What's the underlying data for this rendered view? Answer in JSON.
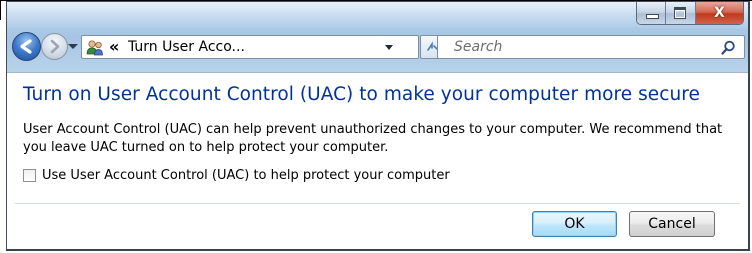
{
  "window": {
    "caption_buttons": {
      "minimize": "minimize",
      "maximize": "maximize",
      "close_glyph": "X"
    }
  },
  "address_bar": {
    "chevron": "«",
    "path_text": "Turn User Acco...",
    "icon": "user-accounts-icon",
    "refresh_glyph": "⁴⁄₊"
  },
  "search": {
    "placeholder": "Search"
  },
  "content": {
    "heading": "Turn on User Account Control (UAC) to make your computer more secure",
    "description": "User Account Control (UAC) can help prevent unauthorized changes to your computer.  We recommend that you leave UAC turned on to help protect your computer.",
    "checkbox_label": "Use User Account Control (UAC) to help protect your computer",
    "checkbox_checked": false
  },
  "buttons": {
    "ok": "OK",
    "cancel": "Cancel"
  },
  "colors": {
    "heading": "#003399",
    "ok_border": "#3c7fb1",
    "close_button": "#c0391f"
  }
}
